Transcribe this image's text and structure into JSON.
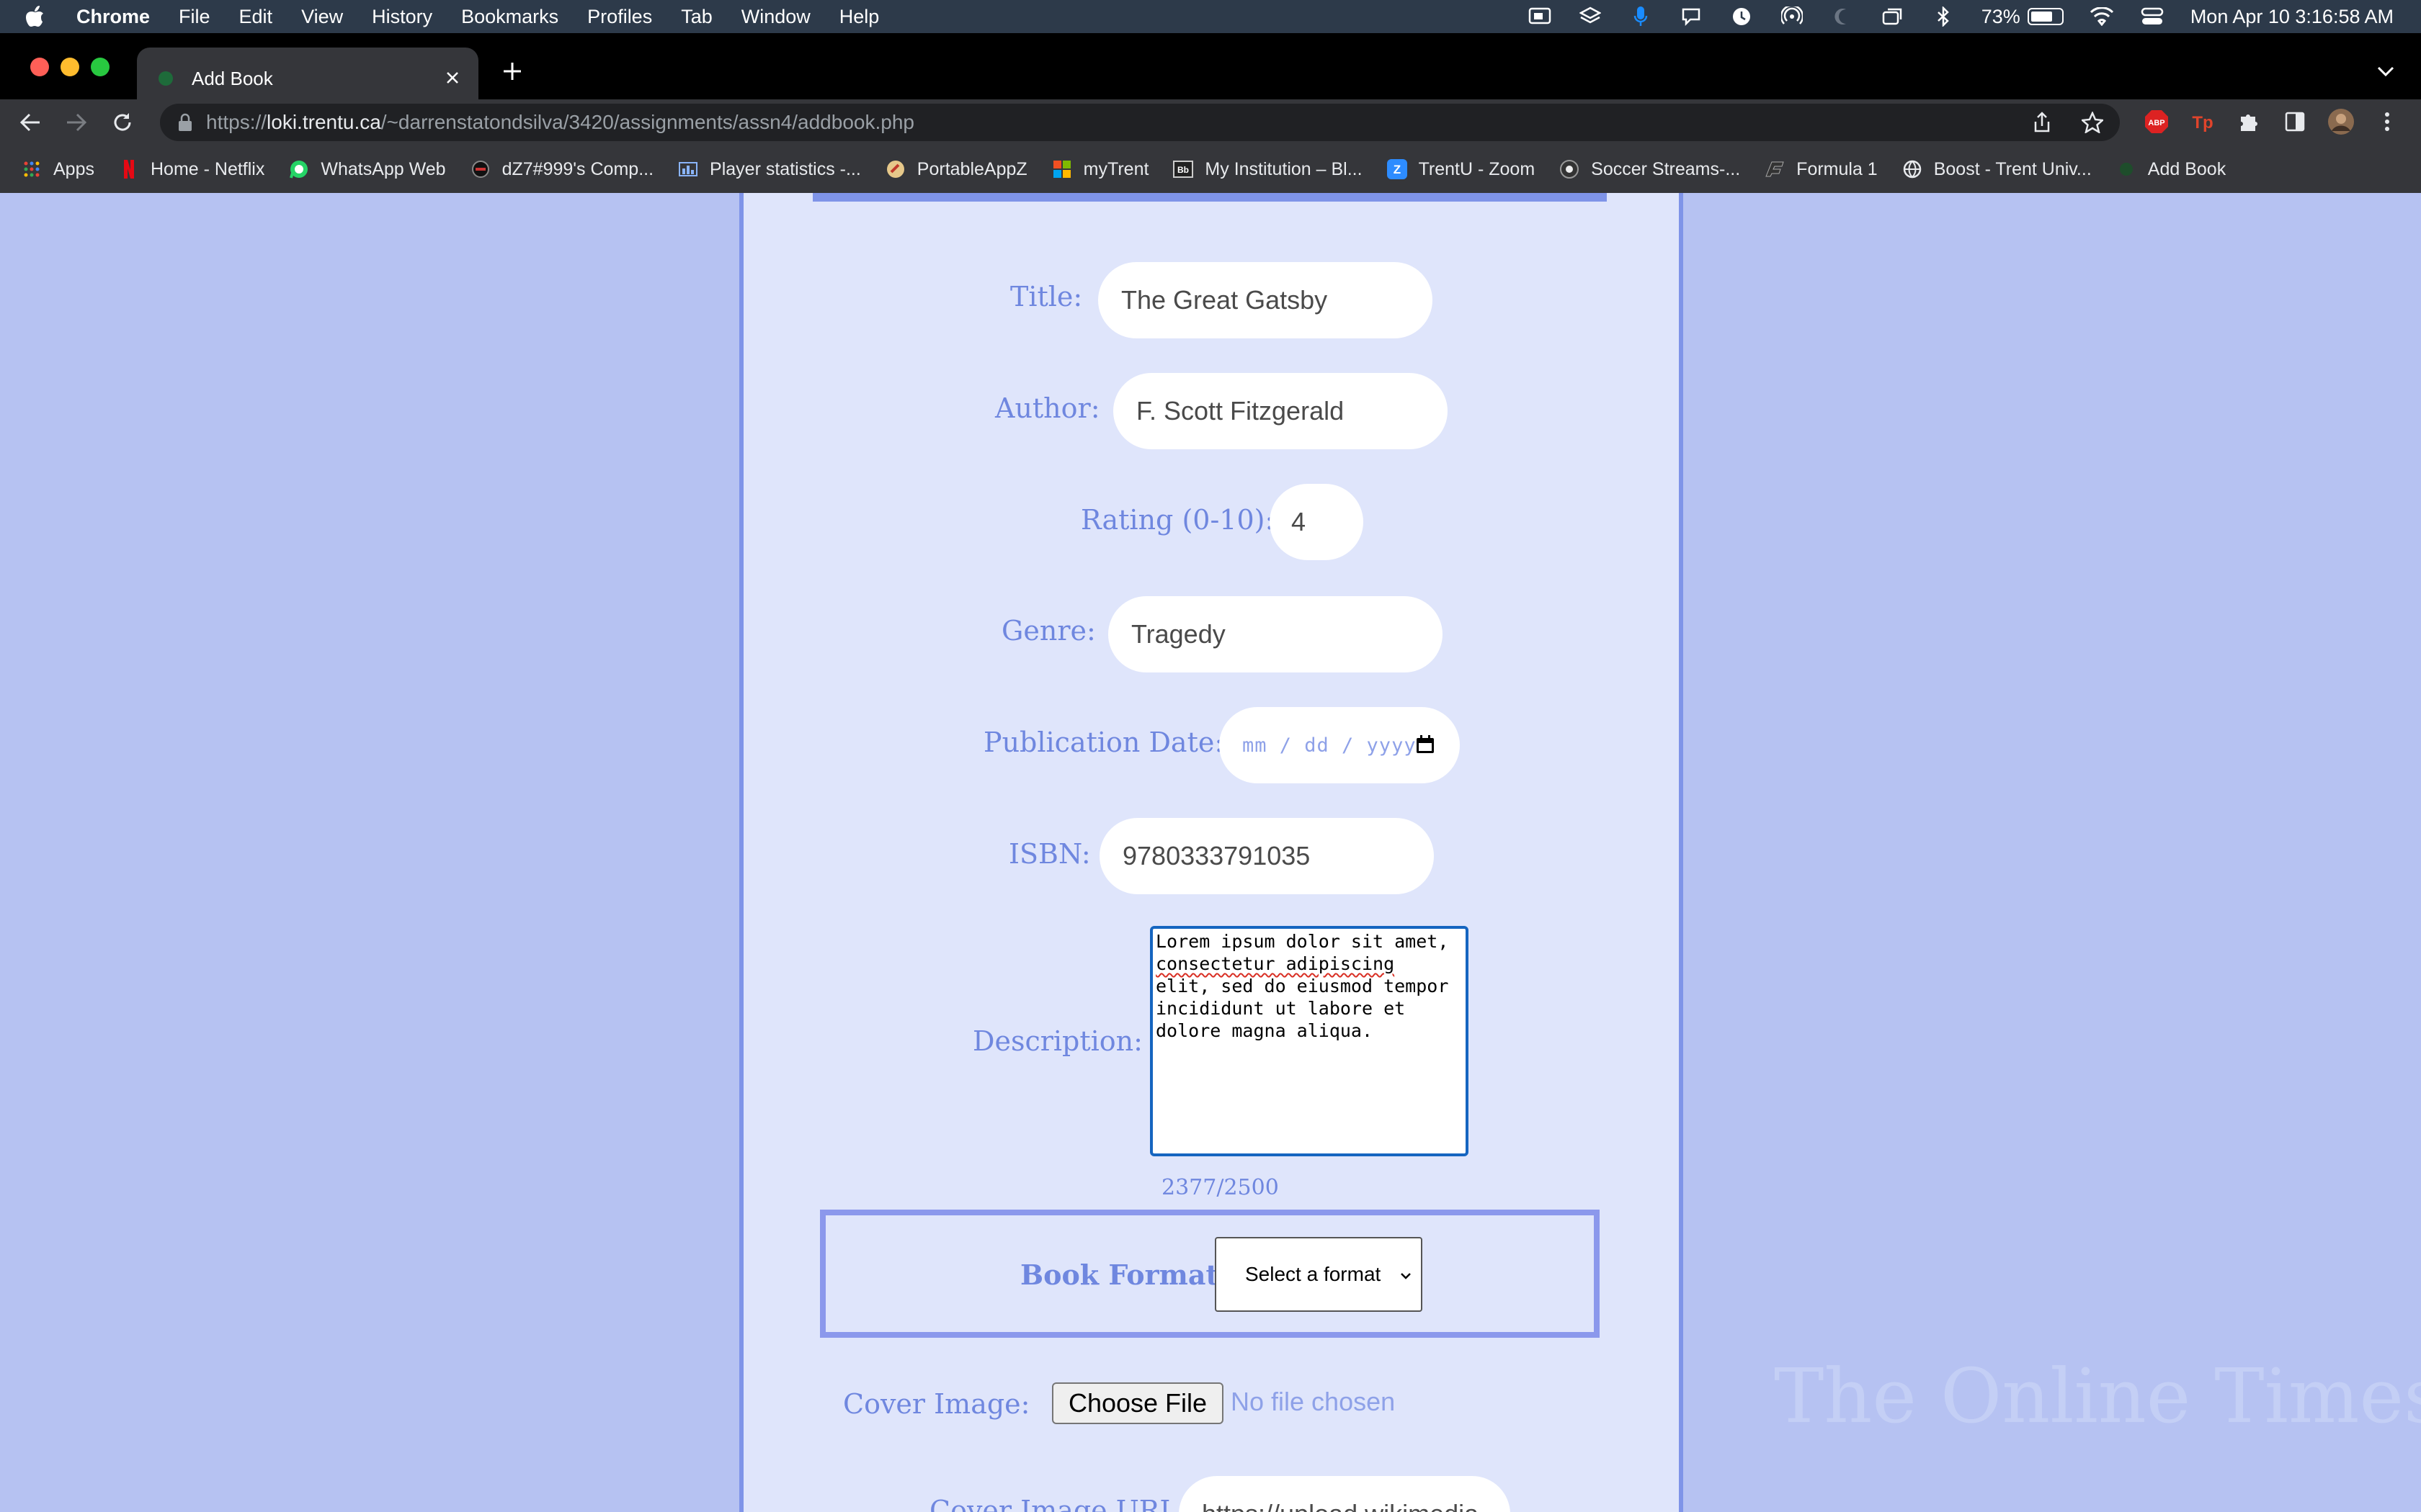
{
  "menubar": {
    "app_name": "Chrome",
    "items": [
      "File",
      "Edit",
      "View",
      "History",
      "Bookmarks",
      "Profiles",
      "Tab",
      "Window",
      "Help"
    ],
    "battery_percent": "73%",
    "battery_level": 0.73,
    "datetime": "Mon Apr 10  3:16:58 AM"
  },
  "browser": {
    "tab_title": "Add Book",
    "url_scheme": "https://",
    "url_host": "loki.trentu.ca",
    "url_path": "/~darrenstatondsilva/3420/assignments/assn4/addbook.php",
    "extensions": [
      "ABP",
      "Tp"
    ]
  },
  "bookmarks": [
    {
      "label": "Apps",
      "icon": "apps-grid-icon"
    },
    {
      "label": "Home - Netflix",
      "icon": "netflix-icon"
    },
    {
      "label": "WhatsApp Web",
      "icon": "whatsapp-icon"
    },
    {
      "label": "dZ7#999's Comp...",
      "icon": "game-stats-icon"
    },
    {
      "label": "Player statistics -...",
      "icon": "stats-icon"
    },
    {
      "label": "PortableAppZ",
      "icon": "portableappz-icon"
    },
    {
      "label": "myTrent",
      "icon": "microsoft-icon"
    },
    {
      "label": "My Institution – Bl...",
      "icon": "blackboard-icon"
    },
    {
      "label": "TrentU - Zoom",
      "icon": "zoom-icon"
    },
    {
      "label": "Soccer Streams-...",
      "icon": "soccer-icon"
    },
    {
      "label": "Formula 1",
      "icon": "f1-icon"
    },
    {
      "label": "Boost - Trent Univ...",
      "icon": "globe-icon"
    },
    {
      "label": "Add Book",
      "icon": "book-icon"
    }
  ],
  "form": {
    "title_label": "Title:",
    "title_value": "The Great Gatsby",
    "author_label": "Author:",
    "author_value": "F. Scott Fitzgerald",
    "rating_label": "Rating (0-10):",
    "rating_value": "4",
    "genre_label": "Genre:",
    "genre_value": "Tragedy",
    "pubdate_label": "Publication Date:",
    "pubdate_placeholder": "mm / dd / yyyy",
    "isbn_label": "ISBN:",
    "isbn_value": "9780333791035",
    "description_label": "Description:",
    "description_lines": [
      "Lorem ipsum dolor sit amet,",
      "consectetur adipiscing",
      "elit, sed do eiusmod tempor",
      "incididunt ut labore et",
      "dolore magna aliqua."
    ],
    "char_counter": "2377/2500",
    "format_label": "Book Format:",
    "format_selected": "Select a format",
    "cover_label": "Cover Image:",
    "choose_file_label": "Choose File",
    "no_file_text": "No file chosen",
    "cover_url_label": "Cover Image URL:",
    "cover_url_value": "https://upload.wikimedia"
  },
  "site": {
    "watermark": "The Online Times"
  },
  "colors": {
    "page_bg": "#b6c2f2",
    "panel_bg": "#dfe5fb",
    "accent": "#7f94e8",
    "label": "#6f87df"
  }
}
